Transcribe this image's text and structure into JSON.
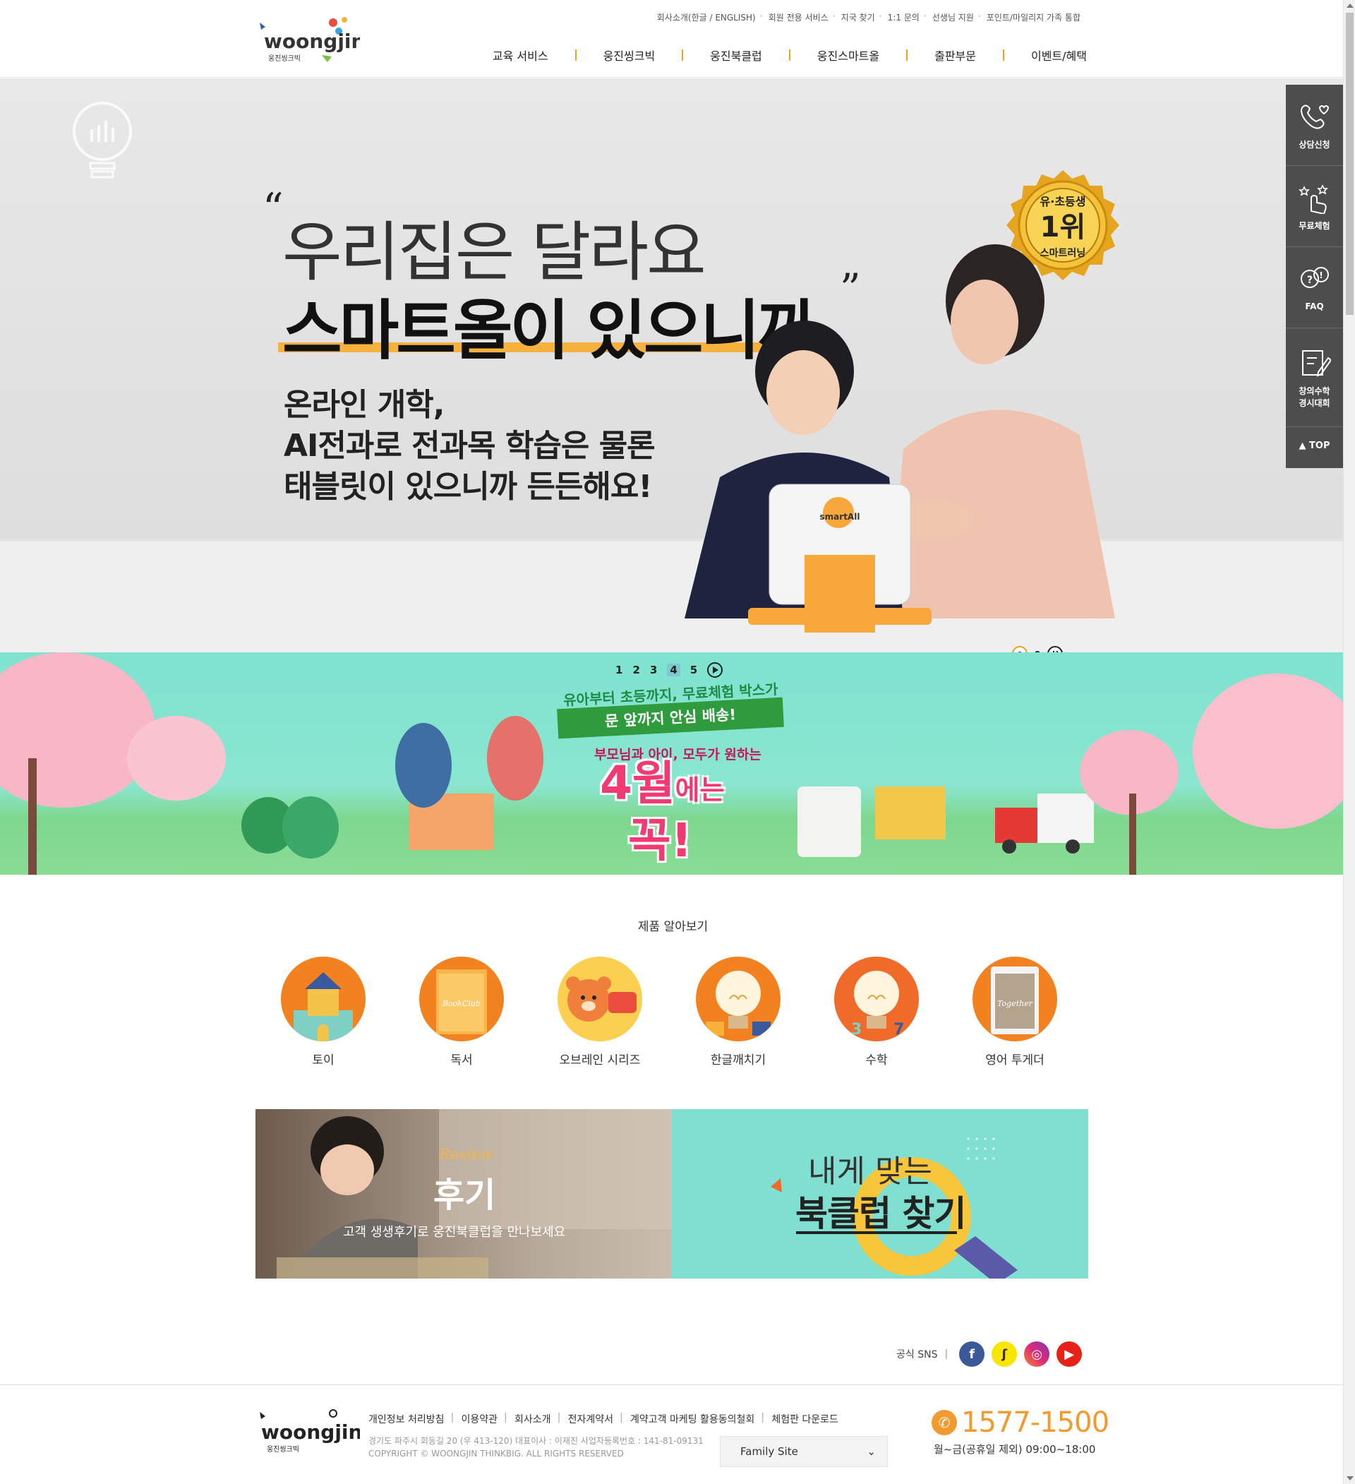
{
  "header": {
    "util_links": [
      "회사소개(한글 / ENGLISH)",
      "회원 전용 서비스",
      "지국 찾기",
      "1:1 문의",
      "선생님 지원",
      "포인트/마일리지 가족 통합"
    ],
    "gnb": [
      "교육 서비스",
      "웅진씽크빅",
      "웅진북클럽",
      "웅진스마트올",
      "출판부문",
      "이벤트/혜택"
    ],
    "logo_text": "woongjin",
    "logo_sub": "웅진씽크빅"
  },
  "hero": {
    "headline1": "우리집은 달라요",
    "headline2": "스마트올이 있으니까",
    "sub_lines": [
      "온라인 개학,",
      "AI전과로 전과목 학습은 물론",
      "태블릿이 있으니까 든든해요!"
    ],
    "badge_top": "유·초등생",
    "badge_mid": "1위",
    "badge_bottom": "스마트러닝",
    "device_label": "smartAll"
  },
  "quick_menu": [
    "상담신청",
    "무료체험",
    "FAQ",
    "창의수학",
    "경시대회",
    "TOP"
  ],
  "promo": {
    "pages": [
      "1",
      "2",
      "3",
      "4",
      "5"
    ],
    "active_page": "4",
    "line1": "유아부터 초등까지, 무료체험 박스가",
    "line2": "문 앞까지 안심 배송!",
    "line3": "부모님과 아이, 모두가 원하는",
    "big1": "4월",
    "big1_suffix": "에는",
    "big2": "꼭!"
  },
  "products": {
    "title": "제품 알아보기",
    "items": [
      "토이",
      "독서",
      "오브레인 시리즈",
      "한글깨치기",
      "수학",
      "영어 투게더"
    ]
  },
  "banners": {
    "review_script": "Review",
    "review_title": "후기",
    "review_desc": "고객 생생후기로 웅진북클럽을 만나보세요",
    "find_line1": "내게 맞는",
    "find_line2": "북클럽 찾기"
  },
  "sns": {
    "label": "공식 SNS"
  },
  "footer": {
    "links": [
      "개인정보 처리방침",
      "이용약관",
      "회사소개",
      "전자계약서",
      "계약고객 마케팅 활용동의철회",
      "체험판 다운로드"
    ],
    "address": "경기도 파주시 회동길 20 (우 413-120) 대표이사 : 이재진 사업자등록번호 : 141-81-09131",
    "copyright": "COPYRIGHT © WOONGJIN THINKBIG. ALL RIGHTS RESERVED",
    "family_site": "Family Site",
    "phone": "1577-1500",
    "hours": "월~금(공휴일 제외) 09:00~18:00"
  },
  "colors": {
    "accent_orange": "#f29a2e",
    "quick_menu_bg": "#4d4d4d",
    "promo_bg": "#7fe3d0",
    "highlight_yellow": "#fbd64a"
  }
}
